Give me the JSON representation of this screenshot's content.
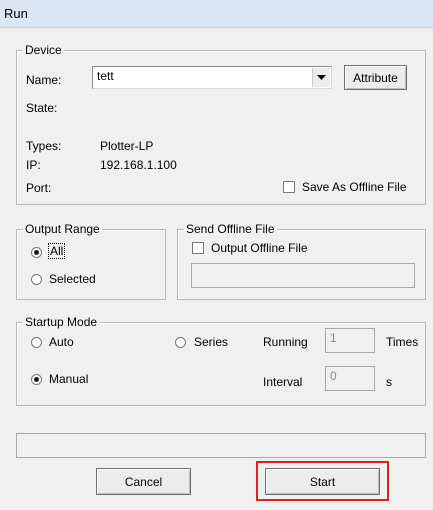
{
  "window": {
    "title": "Run"
  },
  "device": {
    "legend": "Device",
    "name_label": "Name:",
    "name_value": "tett",
    "attribute_button": "Attribute",
    "state_label": "State:",
    "state_value": "",
    "types_label": "Types:",
    "types_value": "Plotter-LP",
    "ip_label": "IP:",
    "ip_value": "192.168.1.100",
    "port_label": "Port:",
    "port_value": "",
    "save_offline_label": "Save As Offline File",
    "save_offline_checked": false
  },
  "output_range": {
    "legend": "Output Range",
    "options": [
      {
        "label": "All",
        "selected": true
      },
      {
        "label": "Selected",
        "selected": false
      }
    ]
  },
  "send_offline": {
    "legend": "Send Offline File",
    "checkbox_label": "Output Offline File",
    "checked": false,
    "path_value": ""
  },
  "startup_mode": {
    "legend": "Startup Mode",
    "options": [
      {
        "label": "Auto",
        "selected": false
      },
      {
        "label": "Series",
        "selected": false
      },
      {
        "label": "Manual",
        "selected": true
      }
    ],
    "running_label": "Running",
    "running_value": "1",
    "times_label": "Times",
    "interval_label": "Interval",
    "interval_value": "0",
    "interval_unit": "s"
  },
  "status_bar": {
    "text": ""
  },
  "buttons": {
    "cancel": "Cancel",
    "start": "Start"
  },
  "colors": {
    "highlight": "#e0221c",
    "titlebar": "#dbe6f4"
  },
  "icons": {
    "dropdown": "chevron-down-icon"
  }
}
